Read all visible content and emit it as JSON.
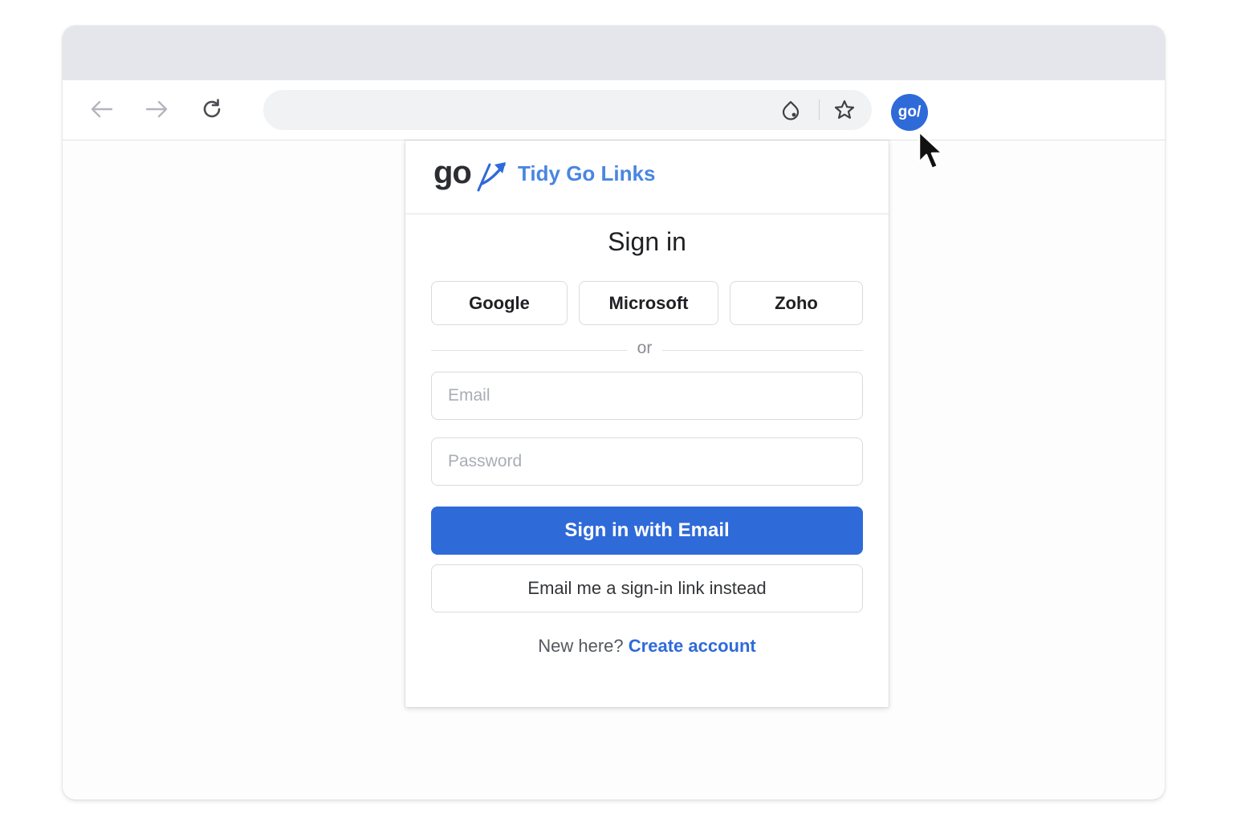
{
  "browser": {
    "extension_badge": "go/"
  },
  "popup": {
    "brand": {
      "logo_text": "go",
      "name": "Tidy Go Links"
    },
    "title": "Sign in",
    "providers": [
      "Google",
      "Microsoft",
      "Zoho"
    ],
    "divider_text": "or",
    "email_placeholder": "Email",
    "password_placeholder": "Password",
    "primary_button": "Sign in with Email",
    "secondary_button": "Email me a sign-in link instead",
    "footer_prompt": "New here?",
    "footer_link": "Create account"
  },
  "colors": {
    "accent": "#2f6ad9",
    "brand_text": "#4a86e0"
  },
  "icons": {
    "back": "arrow-left-icon",
    "forward": "arrow-right-icon",
    "reload": "reload-icon",
    "site_settings": "tune-icon",
    "bookmark": "star-icon",
    "cursor": "mouse-pointer-icon"
  }
}
